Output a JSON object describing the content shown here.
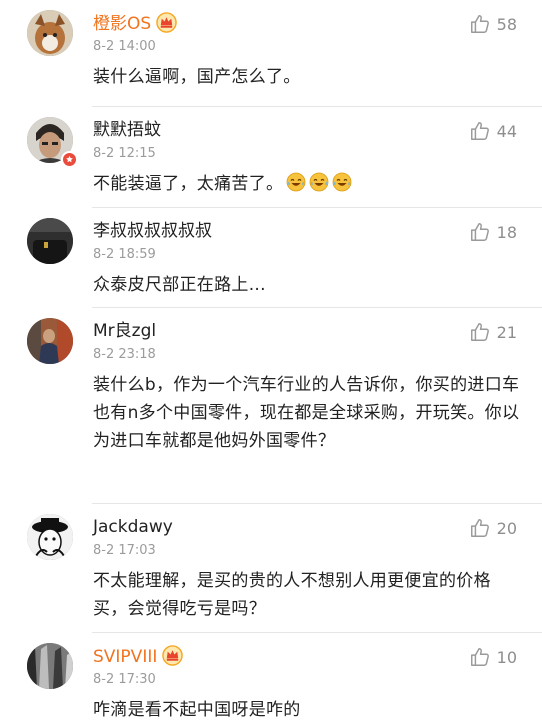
{
  "colors": {
    "vip_name": "#f1741f",
    "meta": "#9b9b9b",
    "text": "#222222",
    "badge": "#e94b3c"
  },
  "icons": {
    "like": "thumbs-up-icon",
    "vip": "crown-icon",
    "verified": "verified-badge-icon",
    "emoji": "laugh-cry-emoji"
  },
  "comments": [
    {
      "user": "橙影OS",
      "time": "8-2 14:00",
      "likes": "58",
      "text": "装什么逼啊，国产怎么了。"
    },
    {
      "user": "默默捂蚊",
      "time": "8-2 12:15",
      "likes": "44",
      "text": "不能装逼了，太痛苦了。"
    },
    {
      "user": "李叔叔叔叔叔叔",
      "time": "8-2 18:59",
      "likes": "18",
      "text": "众泰皮尺部正在路上..."
    },
    {
      "user": "Mr良zgl",
      "time": "8-2 23:18",
      "likes": "21",
      "text": "装什么b，作为一个汽车行业的人告诉你，你买的进口车也有n多个中国零件，现在都是全球采购，开玩笑。你以为进口车就都是他妈外国零件？"
    },
    {
      "user": "Jackdawy",
      "time": "8-2 17:03",
      "likes": "20",
      "text": "不太能理解，是买的贵的人不想别人用更便宜的价格买，会觉得吃亏是吗？"
    },
    {
      "user": "SVIPVIII",
      "time": "8-2 17:30",
      "likes": "10",
      "text": "咋滴是看不起中国呀是咋的"
    }
  ]
}
